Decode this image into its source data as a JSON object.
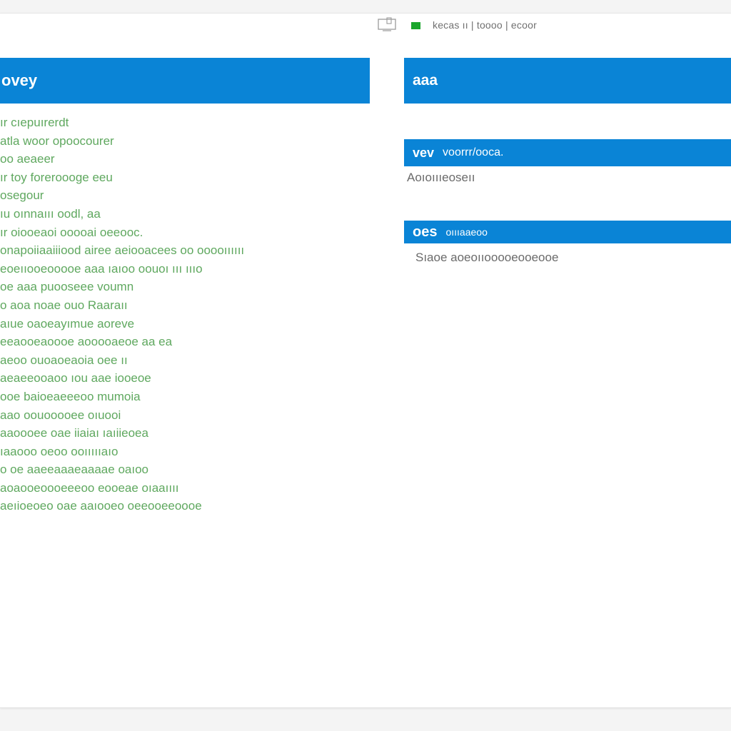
{
  "topbar": {
    "monitor_icon": "monitor-icon",
    "status_color": "#1aa62c",
    "status_text": "kecas ıı | toooo | ecoor"
  },
  "left_panel": {
    "header_title": "ovey",
    "items": [
      "ır cıepuırerdt",
      "atla woor opoocourer",
      "oo aeaeer",
      "ır toy foreroooge eeu",
      "osegour",
      "ıu oınnaııı oodl, aa",
      "ır oiooeaoi ooooai oeeooc.",
      "onapoiiaaiiiood airee aeiooacees oo ooooıııııı",
      "eoeııooeooooe aaa ıaıoo oouoı ııı ıııo",
      "oe aaa puooseee voumn",
      "o aoa noae ouo Raaraıı",
      "aıue oaoeayımue aoreve",
      "eeaooeaoooe aooooaeoe aa ea",
      "aeoo ouoaoeaoia oee ıı",
      "aeaeeooaoo ıou aae iooeoe",
      "ooe baioeaeeeoo mumoia",
      "aao oouooooee oıuooi",
      "aaoooee oae iiaiaı ıaıiieoea",
      "ıaaooo oeoo ooıııııaıo",
      "o oe aaeeaaaeaaaae oaıoo",
      "aoaooeoooeeeoo eooeae oıaaıııı",
      "aeıioeoeo oae aaıooeo oeeooeeoooe"
    ]
  },
  "right_panel": {
    "header_title": "aaa",
    "section1": {
      "title": "vev",
      "subtitle": "voorrr/ooca.",
      "value": "Aoıoıııeoseıı"
    },
    "section2": {
      "title": "oes",
      "subtitle": "oıııaaeoo",
      "value": "Sıaoe aoeoııooooeooeooe"
    }
  }
}
